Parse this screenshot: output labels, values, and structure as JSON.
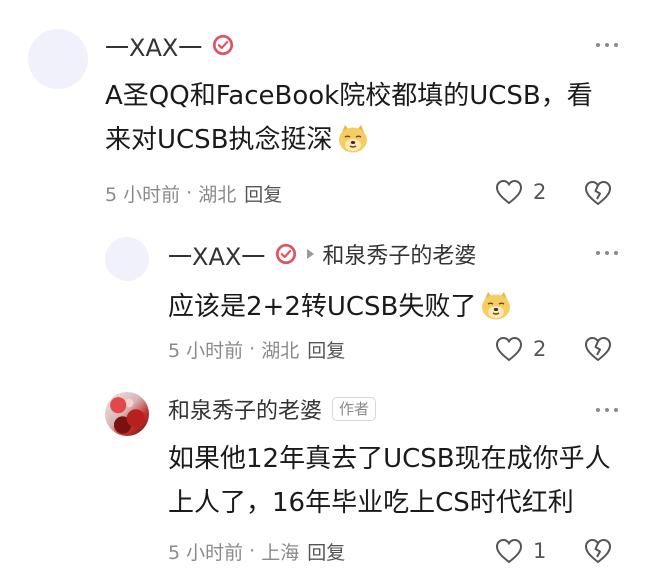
{
  "comments": [
    {
      "username": "一XAX一",
      "verified": true,
      "text_lines": [
        "A圣QQ和FaceBook院校都填的UCSB，看",
        "来对UCSB执念挺深"
      ],
      "emoji": "doge-emoji",
      "time": "5 小时前",
      "location": "湖北",
      "reply_label": "回复",
      "likes": "2"
    },
    {
      "username": "一XAX一",
      "verified": true,
      "reply_to": "和泉秀子的老婆",
      "text_lines": [
        "应该是2+2转UCSB失败了"
      ],
      "emoji": "doge-emoji",
      "time": "5 小时前",
      "location": "湖北",
      "reply_label": "回复",
      "likes": "2"
    },
    {
      "username": "和泉秀子的老婆",
      "author_badge": "作者",
      "text_lines": [
        "如果他12年真去了UCSB现在成你乎人",
        "上人了，16年毕业吃上CS时代红利"
      ],
      "time": "5 小时前",
      "location": "上海",
      "reply_label": "回复",
      "likes": "1"
    }
  ],
  "separator": "·",
  "colors": {
    "verified_badge": "#e05462",
    "meta_text": "#8a8a8a",
    "body_text": "#1a1a1a"
  },
  "icons": {
    "more": "more-dots-icon",
    "like": "heart-icon",
    "dislike": "broken-heart-icon",
    "verified": "verified-badge-icon",
    "emoji": "doge-emoji"
  }
}
